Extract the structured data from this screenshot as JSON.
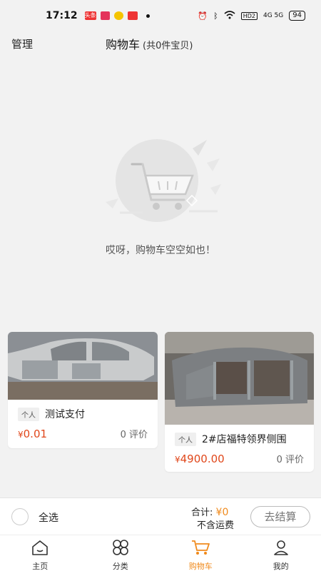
{
  "status_bar": {
    "time": "17:12",
    "battery": "94",
    "app_labels": [
      "头条"
    ],
    "network": "4G 5G",
    "hd": "HD2"
  },
  "header": {
    "manage": "管理",
    "title": "购物车",
    "count": "(共0件宝贝)"
  },
  "empty": {
    "message": "哎呀，购物车空空如也！"
  },
  "products": [
    {
      "tag": "个人",
      "name": "测试支付",
      "currency": "¥",
      "price": "0.01",
      "reviews": "0 评价"
    },
    {
      "tag": "个人",
      "name": "2#店福特领界侧围",
      "currency": "¥",
      "price": "4900.00",
      "reviews": "0 评价"
    }
  ],
  "checkout": {
    "select_all": "全选",
    "total_label": "合计:",
    "total_value": "¥0",
    "shipping": "不含运费",
    "button": "去结算"
  },
  "tabs": [
    {
      "label": "主页",
      "icon": "home-icon",
      "active": false
    },
    {
      "label": "分类",
      "icon": "category-icon",
      "active": false
    },
    {
      "label": "购物车",
      "icon": "cart-icon",
      "active": true
    },
    {
      "label": "我的",
      "icon": "user-icon",
      "active": false
    }
  ],
  "colors": {
    "accent": "#f08a1c",
    "price": "#e0471b",
    "background": "#f2f2f2"
  }
}
